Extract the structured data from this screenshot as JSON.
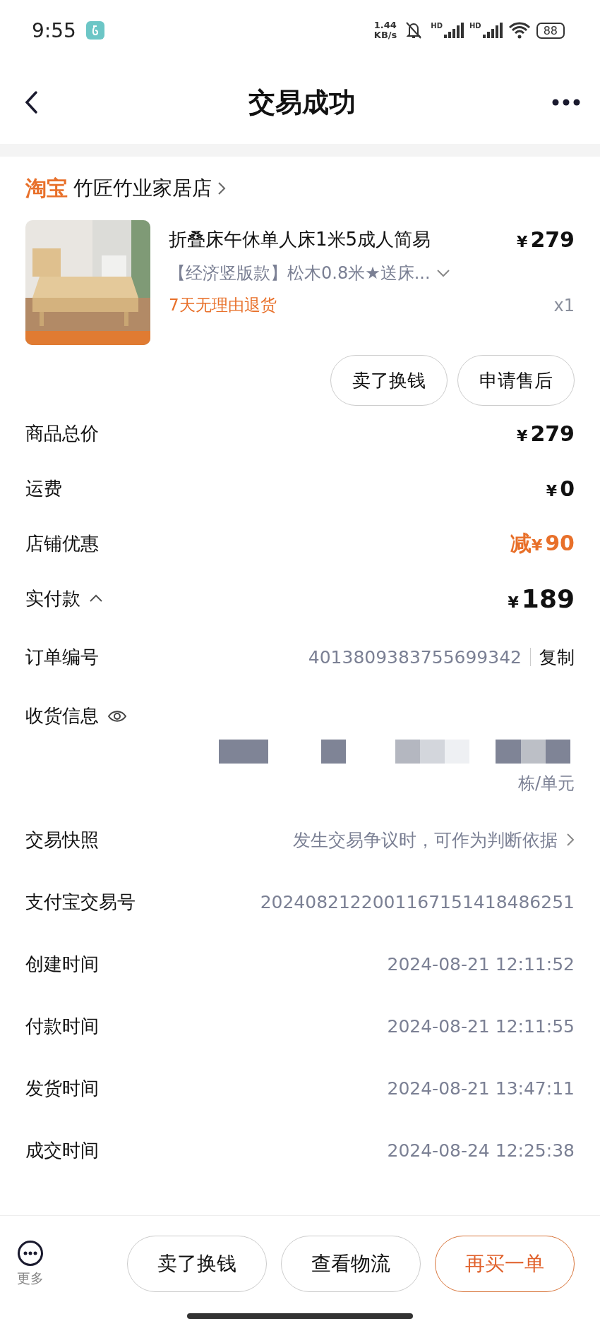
{
  "status_bar": {
    "time": "9:55",
    "net_speed": "1.44",
    "net_unit": "KB/s",
    "signal_labels": [
      "HD",
      "HD"
    ],
    "battery": "88"
  },
  "header": {
    "title": "交易成功"
  },
  "shop": {
    "platform": "淘宝",
    "name": "竹匠竹业家居店"
  },
  "product": {
    "title": "折叠床午休单人床1米5成人简易",
    "currency": "¥",
    "price": "279",
    "spec": "【经济竖版款】松木0.8米★送床...",
    "badge": "7天无理由退货",
    "quantity": "x1",
    "buttons": [
      "卖了换钱",
      "申请售后"
    ]
  },
  "price_rows": [
    {
      "label": "商品总价",
      "currency": "¥",
      "value": "279",
      "kind": "normal"
    },
    {
      "label": "运费",
      "currency": "¥",
      "value": "0",
      "kind": "normal"
    },
    {
      "label": "店铺优惠",
      "prefix": "减",
      "currency": "¥",
      "value": "90",
      "kind": "discount"
    },
    {
      "label": "实付款",
      "currency": "¥",
      "value": "189",
      "kind": "total",
      "expanded": true
    }
  ],
  "order_rows": [
    {
      "label": "订单编号",
      "value": "4013809383755699342",
      "action": "复制",
      "kind": "copy"
    },
    {
      "label": "收货信息",
      "kind": "address",
      "address_tail": "栋/单元"
    },
    {
      "label": "交易快照",
      "value": "发生交易争议时，可作为判断依据",
      "kind": "link"
    },
    {
      "label": "支付宝交易号",
      "value": "2024082122001167151418486251",
      "kind": "text"
    },
    {
      "label": "创建时间",
      "value": "2024-08-21 12:11:52",
      "kind": "text"
    },
    {
      "label": "付款时间",
      "value": "2024-08-21 12:11:55",
      "kind": "text"
    },
    {
      "label": "发货时间",
      "value": "2024-08-21 13:47:11",
      "kind": "text"
    },
    {
      "label": "成交时间",
      "value": "2024-08-24 12:25:38",
      "kind": "text"
    }
  ],
  "bottom_bar": {
    "more_label": "更多",
    "buttons": [
      {
        "label": "卖了换钱",
        "primary": false
      },
      {
        "label": "查看物流",
        "primary": false
      },
      {
        "label": "再买一单",
        "primary": true
      }
    ]
  }
}
